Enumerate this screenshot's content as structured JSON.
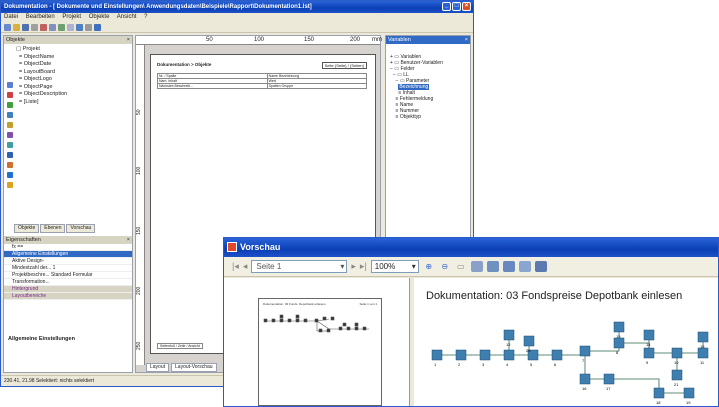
{
  "designer": {
    "title": "Dokumentation - [ Dokumente und Einstellungen\\ Anwendungsdaten\\Beispiele\\Rapport\\Dokumentation1.lst]",
    "menu": [
      "Datei",
      "Bearbeiten",
      "Projekt",
      "Objekte",
      "Ansicht",
      "?"
    ],
    "objects_pane_title": "Objekte",
    "tree": [
      "Projekt",
      "ObjectName",
      "ObjectDate",
      "LayoutBoard",
      "ObjectLogo",
      "ObjectPage",
      "ObjectDescription",
      "[Liste]"
    ],
    "pane_tabs": [
      "Objekte",
      "Ebenen",
      "Vorschau"
    ],
    "props_title": "Eigenschaften",
    "props": [
      {
        "label": "fx ==",
        "type": "row"
      },
      {
        "label": "Allgemeine Einstellungen",
        "type": "sel"
      },
      {
        "label": "Aktive Design-",
        "type": "row"
      },
      {
        "label": "Mindestzahl der...  1",
        "type": "row"
      },
      {
        "label": "Projektbeschre...  Standard Formular",
        "type": "row"
      },
      {
        "label": "Transformation...",
        "type": "row"
      },
      {
        "label": "Hintergrund",
        "type": "cat"
      },
      {
        "label": "Layoutbereiche",
        "type": "cat"
      }
    ],
    "props_description": "Allgemeine Einstellungen",
    "ruler_top": [
      "50",
      "100",
      "150",
      "200",
      "mm"
    ],
    "ruler_left": [
      "50",
      "100",
      "150",
      "200",
      "250"
    ],
    "page_header": "Dokumentation  > Objekte",
    "page_box": "Seite {Seite} / {Seiten}",
    "table_rows": [
      [
        "Nr. / Spalte",
        "Name Bezeichnung"
      ],
      [
        "Nam. Inhalt",
        "Wert"
      ],
      [
        "Nächstes Beschreib...",
        "Spalten Gruppe"
      ]
    ],
    "page_foot": "Seitenfuß  /  Zeile  /  Ansicht",
    "layout_tabs": [
      "Layout",
      "Layout-Vorschau"
    ],
    "variables_title": "Variablen",
    "variables_tree": [
      "Variablen",
      "Benutzer-Variablen",
      "Felder",
      "LL",
      "Parameter",
      "Bezeichnung",
      "Inhalt",
      "Fehlermeldung",
      "Name",
      "Nummer",
      "Objekttyp"
    ],
    "status": "230.41, 21.98  Selektiert:          nichts selektiert"
  },
  "preview": {
    "title": "Vorschau",
    "page_select": "Seite 1",
    "zoom": "100%",
    "heading": "Dokumentation: 03 Fondspreise Depotbank einlesen",
    "thumb_left": "Dokumentation: 03 Fonds. Depotbank einlesen",
    "thumb_right": "Seite 1 von 1",
    "node_labels": [
      "1",
      "2",
      "3",
      "4",
      "5",
      "6",
      "7",
      "8",
      "9",
      "10",
      "11",
      "12",
      "13",
      "14",
      "15",
      "16",
      "17",
      "18",
      "19",
      "20",
      "21"
    ]
  },
  "colors": {
    "title_blue": "#0a3fb5",
    "node_blue": "#3f7fb0",
    "selection": "#316ac5"
  }
}
